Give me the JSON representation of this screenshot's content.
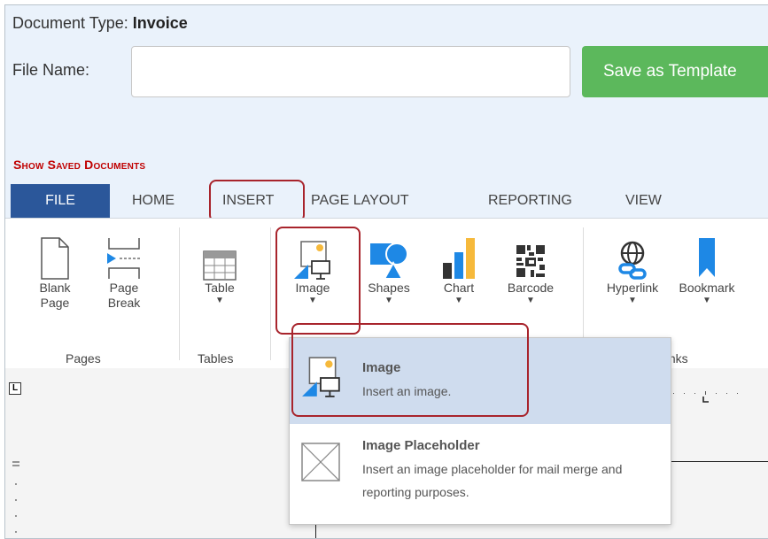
{
  "header": {
    "doc_type_label": "Document Type:",
    "doc_type_value": "Invoice",
    "file_name_label": "File Name:",
    "file_name_value": "",
    "save_button": "Save as Template",
    "show_saved": "Show Saved Documents"
  },
  "tabs": [
    "FILE",
    "HOME",
    "INSERT",
    "PAGE LAYOUT",
    "REPORTING",
    "VIEW"
  ],
  "ribbon": {
    "blank_page": [
      "Blank",
      "Page"
    ],
    "page_break": [
      "Page",
      "Break"
    ],
    "table": "Table",
    "image": "Image",
    "shapes": "Shapes",
    "chart": "Chart",
    "barcode": "Barcode",
    "hyperlink": "Hyperlink",
    "bookmark": "Bookmark",
    "caret": "▼",
    "groups": {
      "pages": "Pages",
      "tables": "Tables",
      "links": "Links"
    }
  },
  "ruler": {
    "corner": "L"
  },
  "dropdown": {
    "image": {
      "title": "Image",
      "desc": "Insert an image."
    },
    "placeholder": {
      "title": "Image Placeholder",
      "desc": "Insert an image placeholder for mail merge and reporting purposes."
    }
  },
  "colors": {
    "file_tab": "#2b579a",
    "save_button": "#5cb85c",
    "highlight": "#a8242c",
    "show_saved": "#c00000",
    "accent_blue": "#1e88e5",
    "chart_yellow": "#f6b93b"
  }
}
